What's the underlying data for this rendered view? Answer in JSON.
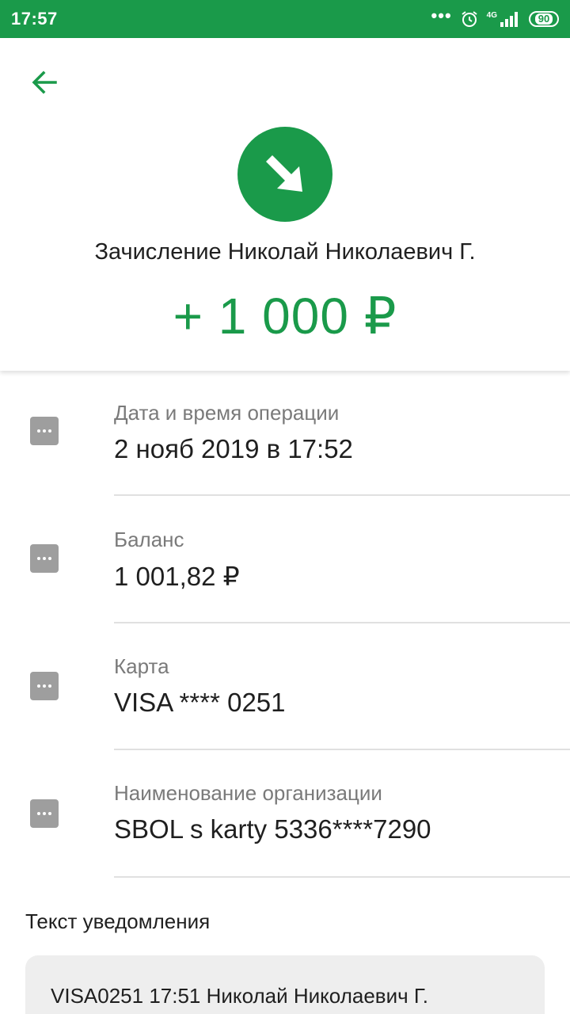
{
  "status_bar": {
    "time": "17:57",
    "battery": "90",
    "network": "4G",
    "icons": [
      "more-dots-icon",
      "alarm-icon",
      "signal-icon",
      "battery-icon"
    ]
  },
  "header": {
    "back_icon": "arrow-left-icon",
    "operation_icon": "incoming-arrow-icon",
    "title": "Зачисление Николай Николаевич Г.",
    "amount": "+ 1 000 ₽"
  },
  "details": [
    {
      "label": "Дата и время операции",
      "value": "2 нояб 2019 в 17:52"
    },
    {
      "label": "Баланс",
      "value": "1 001,82 ₽"
    },
    {
      "label": "Карта",
      "value": "VISA **** 0251"
    },
    {
      "label": "Наименование организации",
      "value": "SBOL s karty 5336****7290"
    }
  ],
  "notification": {
    "title": "Текст уведомления",
    "text": "VISA0251 17:51 Николай Николаевич Г."
  },
  "colors": {
    "accent": "#1a9a4a",
    "label_gray": "#7a7a7a",
    "icon_gray": "#9e9e9e"
  }
}
